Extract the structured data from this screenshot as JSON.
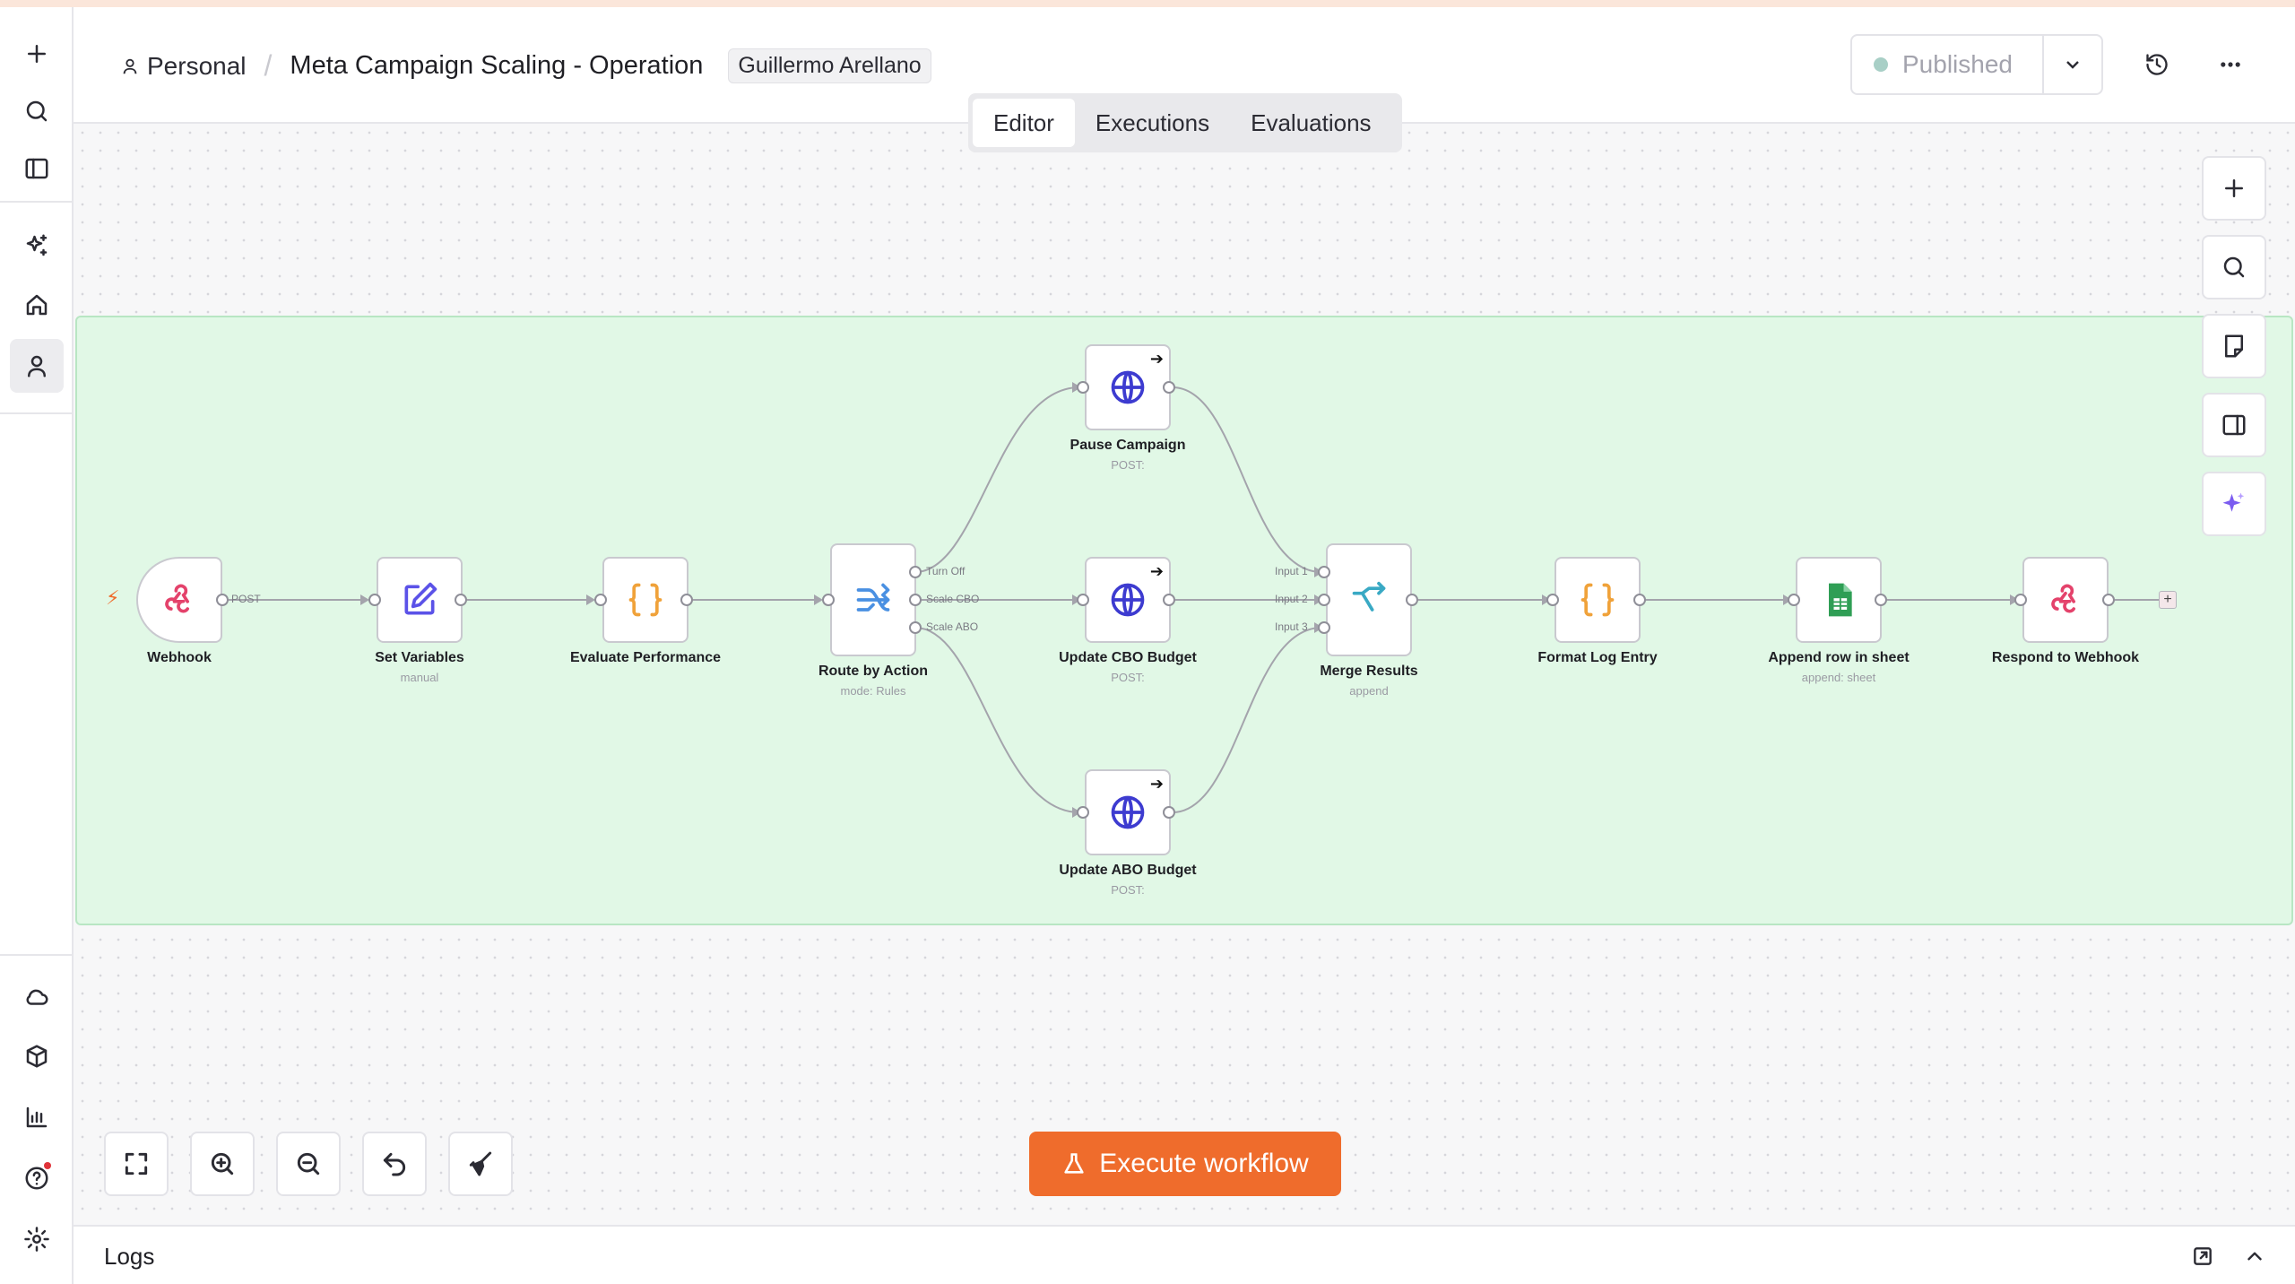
{
  "header": {
    "project": "Personal",
    "workflow_name": "Meta Campaign Scaling - Operation",
    "owner": "Guillermo Arellano",
    "publish_status": "Published"
  },
  "tabs": [
    {
      "label": "Editor",
      "active": true
    },
    {
      "label": "Executions",
      "active": false
    },
    {
      "label": "Evaluations",
      "active": false
    }
  ],
  "nodes": {
    "webhook": {
      "label": "Webhook",
      "out_label": "POST"
    },
    "set_variables": {
      "label": "Set Variables",
      "sub": "manual"
    },
    "evaluate": {
      "label": "Evaluate Performance"
    },
    "route": {
      "label": "Route by Action",
      "sub": "mode: Rules",
      "outputs": [
        "Turn Off",
        "Scale CBO",
        "Scale ABO"
      ]
    },
    "pause": {
      "label": "Pause Campaign",
      "sub": "POST:"
    },
    "cbo": {
      "label": "Update CBO Budget",
      "sub": "POST:"
    },
    "abo": {
      "label": "Update ABO Budget",
      "sub": "POST:"
    },
    "merge": {
      "label": "Merge Results",
      "sub": "append",
      "inputs": [
        "Input 1",
        "Input 2",
        "Input 3"
      ]
    },
    "format": {
      "label": "Format Log Entry"
    },
    "append": {
      "label": "Append row in sheet",
      "sub": "append: sheet"
    },
    "respond": {
      "label": "Respond to Webhook"
    }
  },
  "execute_button": "Execute workflow",
  "logs": {
    "title": "Logs"
  },
  "colors": {
    "accent": "#ef6c2c",
    "sticky_bg": "#e1f8e6",
    "webhook_icon": "#e4426b",
    "http_icon": "#3d3bd0",
    "code_icon": "#f0a23a",
    "switch_icon": "#4a90e2",
    "merge_icon": "#39a9c4",
    "sheets_icon": "#2f9e55",
    "set_icon": "#5b52e8"
  },
  "icons": {
    "rail": [
      "plus-icon",
      "search-icon",
      "sidebar-icon",
      "sparkles-icon",
      "home-icon",
      "user-icon",
      "cloud-icon",
      "box-icon",
      "chart-icon",
      "help-icon",
      "gear-icon"
    ],
    "header": [
      "history-icon",
      "more-icon"
    ],
    "side_tools": [
      "plus-icon",
      "search-icon",
      "sticky-note-icon",
      "panel-icon",
      "ai-sparkle-icon"
    ],
    "zoom_tools": [
      "fit-view-icon",
      "zoom-in-icon",
      "zoom-out-icon",
      "undo-icon",
      "tidy-up-icon"
    ]
  }
}
